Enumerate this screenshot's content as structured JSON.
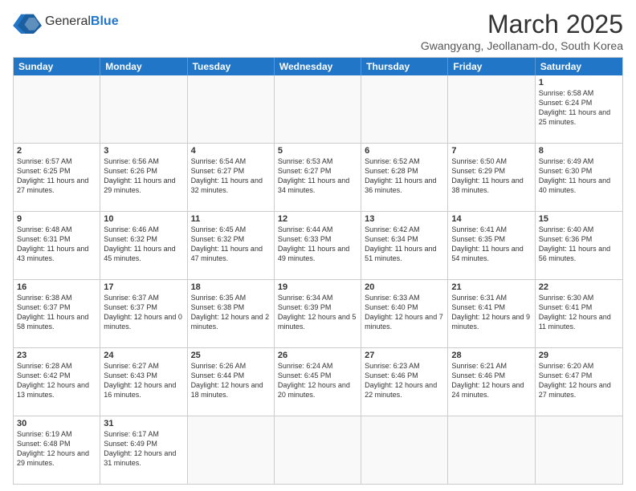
{
  "header": {
    "logo_general": "General",
    "logo_blue": "Blue",
    "month_title": "March 2025",
    "subtitle": "Gwangyang, Jeollanam-do, South Korea"
  },
  "weekdays": [
    "Sunday",
    "Monday",
    "Tuesday",
    "Wednesday",
    "Thursday",
    "Friday",
    "Saturday"
  ],
  "rows": [
    [
      {
        "day": "",
        "info": ""
      },
      {
        "day": "",
        "info": ""
      },
      {
        "day": "",
        "info": ""
      },
      {
        "day": "",
        "info": ""
      },
      {
        "day": "",
        "info": ""
      },
      {
        "day": "",
        "info": ""
      },
      {
        "day": "1",
        "info": "Sunrise: 6:58 AM\nSunset: 6:24 PM\nDaylight: 11 hours and 25 minutes."
      }
    ],
    [
      {
        "day": "2",
        "info": "Sunrise: 6:57 AM\nSunset: 6:25 PM\nDaylight: 11 hours and 27 minutes."
      },
      {
        "day": "3",
        "info": "Sunrise: 6:56 AM\nSunset: 6:26 PM\nDaylight: 11 hours and 29 minutes."
      },
      {
        "day": "4",
        "info": "Sunrise: 6:54 AM\nSunset: 6:27 PM\nDaylight: 11 hours and 32 minutes."
      },
      {
        "day": "5",
        "info": "Sunrise: 6:53 AM\nSunset: 6:27 PM\nDaylight: 11 hours and 34 minutes."
      },
      {
        "day": "6",
        "info": "Sunrise: 6:52 AM\nSunset: 6:28 PM\nDaylight: 11 hours and 36 minutes."
      },
      {
        "day": "7",
        "info": "Sunrise: 6:50 AM\nSunset: 6:29 PM\nDaylight: 11 hours and 38 minutes."
      },
      {
        "day": "8",
        "info": "Sunrise: 6:49 AM\nSunset: 6:30 PM\nDaylight: 11 hours and 40 minutes."
      }
    ],
    [
      {
        "day": "9",
        "info": "Sunrise: 6:48 AM\nSunset: 6:31 PM\nDaylight: 11 hours and 43 minutes."
      },
      {
        "day": "10",
        "info": "Sunrise: 6:46 AM\nSunset: 6:32 PM\nDaylight: 11 hours and 45 minutes."
      },
      {
        "day": "11",
        "info": "Sunrise: 6:45 AM\nSunset: 6:32 PM\nDaylight: 11 hours and 47 minutes."
      },
      {
        "day": "12",
        "info": "Sunrise: 6:44 AM\nSunset: 6:33 PM\nDaylight: 11 hours and 49 minutes."
      },
      {
        "day": "13",
        "info": "Sunrise: 6:42 AM\nSunset: 6:34 PM\nDaylight: 11 hours and 51 minutes."
      },
      {
        "day": "14",
        "info": "Sunrise: 6:41 AM\nSunset: 6:35 PM\nDaylight: 11 hours and 54 minutes."
      },
      {
        "day": "15",
        "info": "Sunrise: 6:40 AM\nSunset: 6:36 PM\nDaylight: 11 hours and 56 minutes."
      }
    ],
    [
      {
        "day": "16",
        "info": "Sunrise: 6:38 AM\nSunset: 6:37 PM\nDaylight: 11 hours and 58 minutes."
      },
      {
        "day": "17",
        "info": "Sunrise: 6:37 AM\nSunset: 6:37 PM\nDaylight: 12 hours and 0 minutes."
      },
      {
        "day": "18",
        "info": "Sunrise: 6:35 AM\nSunset: 6:38 PM\nDaylight: 12 hours and 2 minutes."
      },
      {
        "day": "19",
        "info": "Sunrise: 6:34 AM\nSunset: 6:39 PM\nDaylight: 12 hours and 5 minutes."
      },
      {
        "day": "20",
        "info": "Sunrise: 6:33 AM\nSunset: 6:40 PM\nDaylight: 12 hours and 7 minutes."
      },
      {
        "day": "21",
        "info": "Sunrise: 6:31 AM\nSunset: 6:41 PM\nDaylight: 12 hours and 9 minutes."
      },
      {
        "day": "22",
        "info": "Sunrise: 6:30 AM\nSunset: 6:41 PM\nDaylight: 12 hours and 11 minutes."
      }
    ],
    [
      {
        "day": "23",
        "info": "Sunrise: 6:28 AM\nSunset: 6:42 PM\nDaylight: 12 hours and 13 minutes."
      },
      {
        "day": "24",
        "info": "Sunrise: 6:27 AM\nSunset: 6:43 PM\nDaylight: 12 hours and 16 minutes."
      },
      {
        "day": "25",
        "info": "Sunrise: 6:26 AM\nSunset: 6:44 PM\nDaylight: 12 hours and 18 minutes."
      },
      {
        "day": "26",
        "info": "Sunrise: 6:24 AM\nSunset: 6:45 PM\nDaylight: 12 hours and 20 minutes."
      },
      {
        "day": "27",
        "info": "Sunrise: 6:23 AM\nSunset: 6:46 PM\nDaylight: 12 hours and 22 minutes."
      },
      {
        "day": "28",
        "info": "Sunrise: 6:21 AM\nSunset: 6:46 PM\nDaylight: 12 hours and 24 minutes."
      },
      {
        "day": "29",
        "info": "Sunrise: 6:20 AM\nSunset: 6:47 PM\nDaylight: 12 hours and 27 minutes."
      }
    ],
    [
      {
        "day": "30",
        "info": "Sunrise: 6:19 AM\nSunset: 6:48 PM\nDaylight: 12 hours and 29 minutes."
      },
      {
        "day": "31",
        "info": "Sunrise: 6:17 AM\nSunset: 6:49 PM\nDaylight: 12 hours and 31 minutes."
      },
      {
        "day": "",
        "info": ""
      },
      {
        "day": "",
        "info": ""
      },
      {
        "day": "",
        "info": ""
      },
      {
        "day": "",
        "info": ""
      },
      {
        "day": "",
        "info": ""
      }
    ]
  ]
}
